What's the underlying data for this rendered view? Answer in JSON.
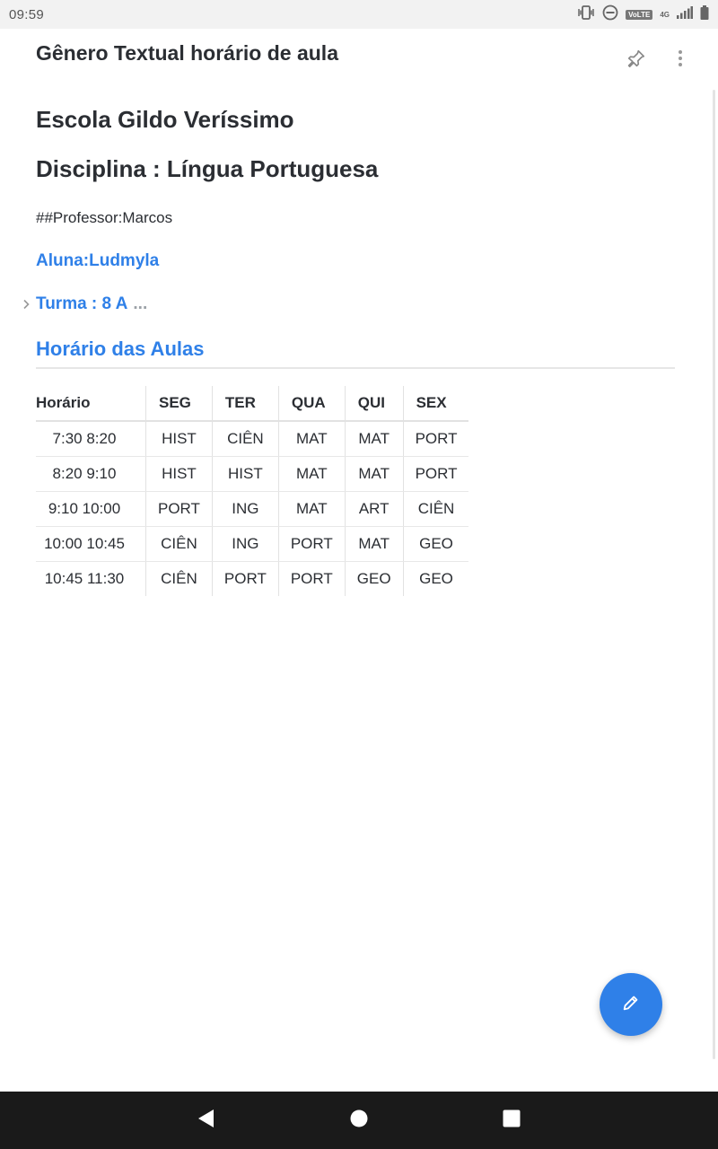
{
  "status_bar": {
    "time": "09:59",
    "volte": "VoLTE",
    "network": "4G",
    "icons": [
      "vibrate-icon",
      "do-not-disturb-icon",
      "volte-icon",
      "signal-icon",
      "battery-icon"
    ]
  },
  "header": {
    "title": "Gênero Textual horário de aula",
    "icons": [
      "pin-icon",
      "more-vert-icon"
    ]
  },
  "document": {
    "school": "Escola Gildo Veríssimo",
    "discipline": "Disciplina : Língua Portuguesa",
    "professor": "##Professor:Marcos",
    "student": "Aluna:Ludmyla",
    "class": "Turma : 8 A",
    "class_collapsed_indicator": "...",
    "schedule_heading": "Horário das Aulas"
  },
  "schedule": {
    "headers": [
      "Horário",
      "SEG",
      "TER",
      "QUA",
      "QUI",
      "SEX"
    ],
    "rows": [
      [
        "7:30 8:20",
        "HIST",
        "CIÊN",
        "MAT",
        "MAT",
        "PORT"
      ],
      [
        "8:20 9:10",
        "HIST",
        "HIST",
        "MAT",
        "MAT",
        "PORT"
      ],
      [
        "9:10 10:00",
        "PORT",
        "ING",
        "MAT",
        "ART",
        "CIÊN"
      ],
      [
        "10:00 10:45",
        "CIÊN",
        "ING",
        "PORT",
        "MAT",
        "GEO"
      ],
      [
        "10:45 11:30",
        "CIÊN",
        "PORT",
        "PORT",
        "GEO",
        "GEO"
      ]
    ]
  },
  "fab": {
    "icon": "edit-pencil-icon"
  },
  "nav_bar": {
    "icons": [
      "back-icon",
      "home-icon",
      "recents-icon"
    ]
  },
  "colors": {
    "accent": "#2f80e8",
    "text": "#2b2e33",
    "muted": "#9aa0a6",
    "navbar": "#1a1a1a"
  }
}
